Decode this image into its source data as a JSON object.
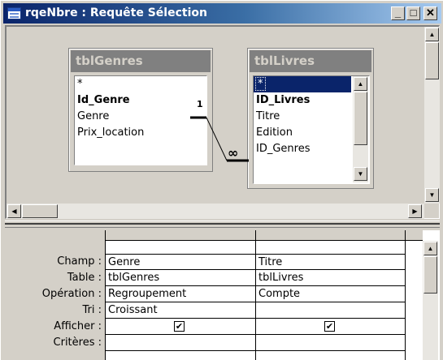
{
  "window": {
    "title": "rqeNbre : Requête Sélection",
    "minimize": "_",
    "maximize": "□",
    "close": "✕"
  },
  "tables": [
    {
      "name": "tblGenres",
      "fields": [
        {
          "label": "*",
          "key": false,
          "selected": false
        },
        {
          "label": "Id_Genre",
          "key": true,
          "selected": false
        },
        {
          "label": "Genre",
          "key": false,
          "selected": false
        },
        {
          "label": "Prix_location",
          "key": false,
          "selected": false
        }
      ]
    },
    {
      "name": "tblLivres",
      "fields": [
        {
          "label": "*",
          "key": false,
          "selected": true
        },
        {
          "label": "ID_Livres",
          "key": true,
          "selected": false
        },
        {
          "label": "Titre",
          "key": false,
          "selected": false
        },
        {
          "label": "Edition",
          "key": false,
          "selected": false
        },
        {
          "label": "ID_Genres",
          "key": false,
          "selected": false
        }
      ]
    }
  ],
  "relationship": {
    "one_side": "1",
    "many_side": "∞"
  },
  "grid": {
    "row_labels": [
      "Champ :",
      "Table :",
      "Opération :",
      "Tri :",
      "Afficher :",
      "Critères :"
    ],
    "columns": [
      {
        "champ": "Genre",
        "table": "tblGenres",
        "operation": "Regroupement",
        "tri": "Croissant",
        "afficher": true,
        "criteres": ""
      },
      {
        "champ": "Titre",
        "table": "tblLivres",
        "operation": "Compte",
        "tri": "",
        "afficher": true,
        "criteres": ""
      }
    ]
  },
  "icons": {
    "app": "query-window-icon",
    "scroll_up": "▲",
    "scroll_down": "▼",
    "scroll_left": "◀",
    "scroll_right": "▶",
    "check": "✔"
  }
}
